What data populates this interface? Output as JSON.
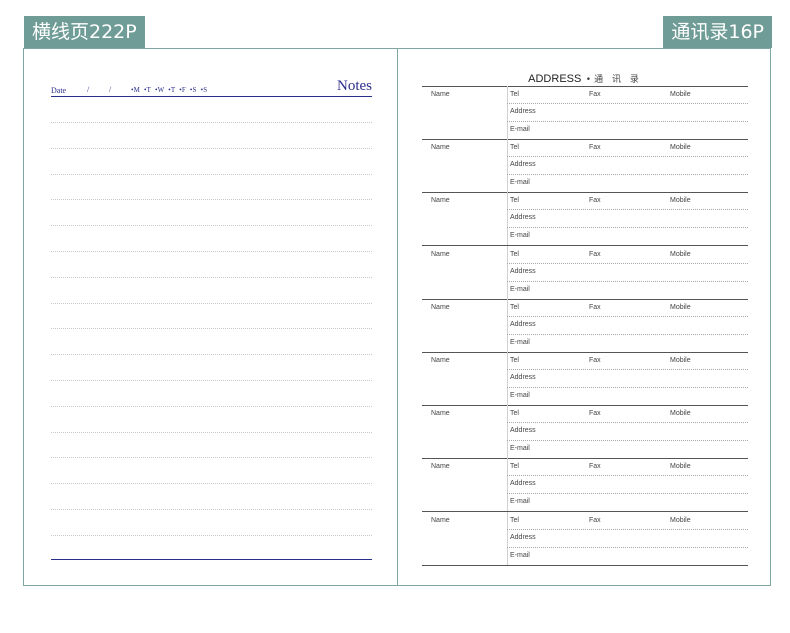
{
  "tags": {
    "left": "横线页222P",
    "right": "通讯录16P"
  },
  "notes_page": {
    "date_label": "Date",
    "slash": "/",
    "days": "•M •T •W •T •F •S •S",
    "title": "Notes",
    "ruled_lines": 17
  },
  "address_page": {
    "title_en": "ADDRESS",
    "title_cn": "•通 讯 录",
    "entry_count": 9,
    "labels": {
      "name": "Name",
      "tel": "Tel",
      "fax": "Fax",
      "mobile": "Mobile",
      "address": "Address",
      "email": "E-mail"
    }
  }
}
